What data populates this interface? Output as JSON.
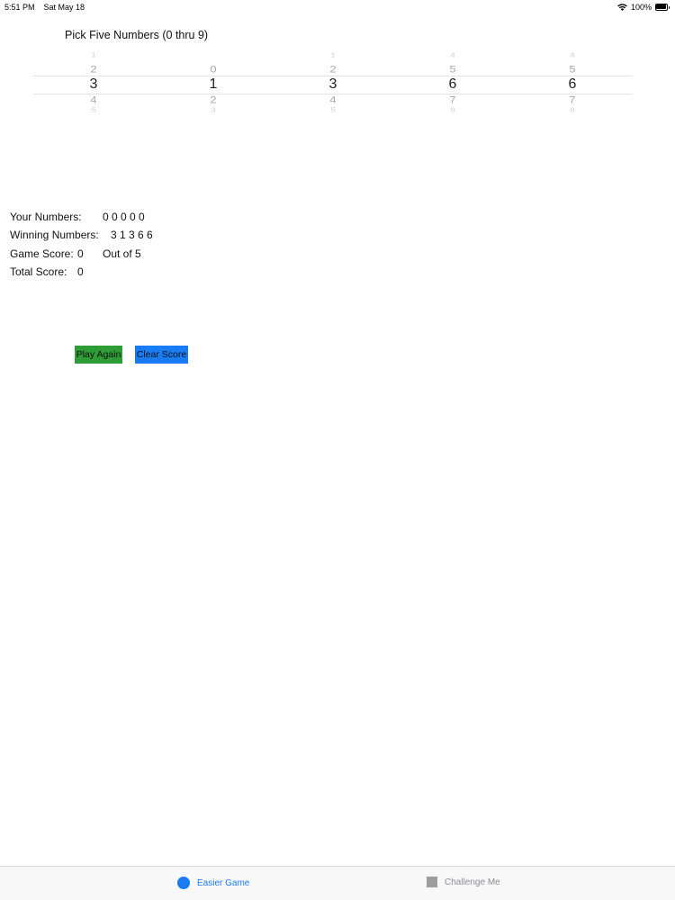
{
  "status_bar": {
    "time": "5:51 PM",
    "date": "Sat May 18",
    "battery": "100%"
  },
  "picker": {
    "title": "Pick Five Numbers (0 thru 9)",
    "columns": [
      {
        "above2": "1",
        "above1": "2",
        "selected": "3",
        "below1": "4",
        "below2": "5"
      },
      {
        "above2": "",
        "above1": "0",
        "selected": "1",
        "below1": "2",
        "below2": "3"
      },
      {
        "above2": "1",
        "above1": "2",
        "selected": "3",
        "below1": "4",
        "below2": "5"
      },
      {
        "above2": "4",
        "above1": "5",
        "selected": "6",
        "below1": "7",
        "below2": "8"
      },
      {
        "above2": "4",
        "above1": "5",
        "selected": "6",
        "below1": "7",
        "below2": "8"
      }
    ]
  },
  "results": {
    "your_numbers_label": "Your Numbers:",
    "your_numbers_value": "0 0 0 0 0",
    "winning_numbers_label": "Winning Numbers:",
    "winning_numbers_value": "3 1 3 6 6",
    "game_score_label": "Game Score:",
    "game_score_value": "0",
    "out_of_label": "Out of 5",
    "total_score_label": "Total Score:",
    "total_score_value": "0"
  },
  "buttons": {
    "play_again": "Play Again",
    "clear_score": "Clear Score"
  },
  "tab_bar": {
    "tabs": [
      {
        "label": "Easier Game",
        "icon": "circle-icon",
        "selected": true
      },
      {
        "label": "Challenge Me",
        "icon": "square-icon",
        "selected": false
      }
    ]
  },
  "colors": {
    "accent": "#1a7cf5",
    "play_button": "#2e9c37",
    "clear_button": "#1a7cf5",
    "tab_inactive": "#8e8e93"
  }
}
